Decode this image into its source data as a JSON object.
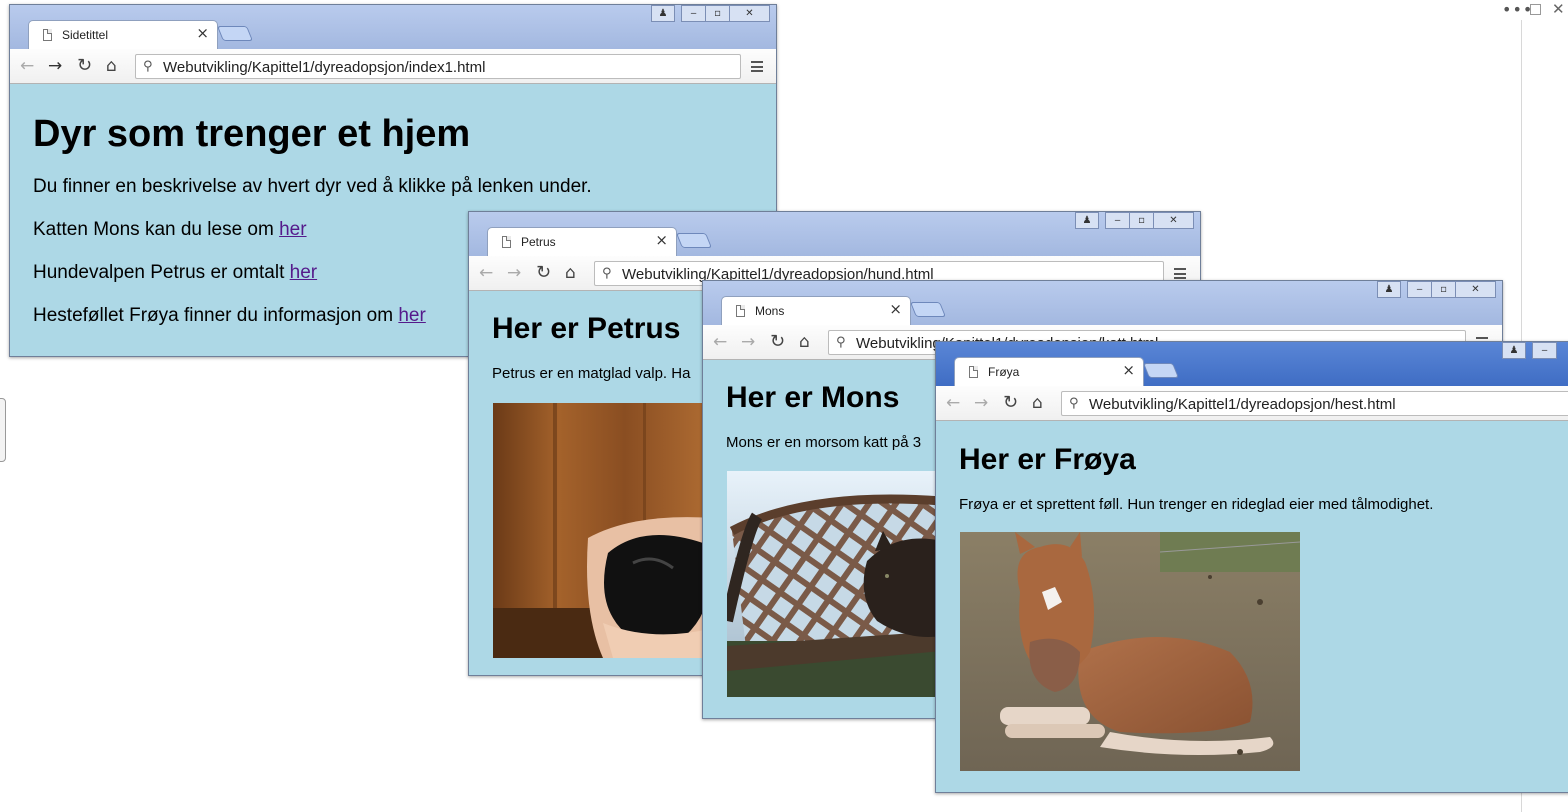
{
  "windows": {
    "index": {
      "tab_title": "Sidetittel",
      "url": "Webutvikling/Kapittel1/dyreadopsjon/index1.html",
      "heading": "Dyr som trenger et hjem",
      "intro": "Du finner en beskrivelse av hvert dyr ved å klikke på lenken under.",
      "lines": [
        {
          "text": "Katten Mons kan du lese om ",
          "link": "her"
        },
        {
          "text": "Hundevalpen Petrus er omtalt ",
          "link": "her"
        },
        {
          "text": "Hesteføllet Frøya finner du informasjon om ",
          "link": "her"
        }
      ]
    },
    "hund": {
      "tab_title": "Petrus",
      "url": "Webutvikling/Kapittel1/dyreadopsjon/hund.html",
      "heading": "Her er Petrus",
      "text": "Petrus er en matglad valp. Ha"
    },
    "katt": {
      "tab_title": "Mons",
      "url": "Webutvikling/Kapittel1/dyreadopsjon/katt.html",
      "heading": "Her er Mons",
      "text": "Mons er en morsom katt på 3"
    },
    "hest": {
      "tab_title": "Frøya",
      "url": "Webutvikling/Kapittel1/dyreadopsjon/hest.html",
      "heading": "Her er Frøya",
      "text": "Frøya er et sprettent føll. Hun trenger en rideglad eier med tålmodighet."
    }
  },
  "icons": {
    "page": "page-icon",
    "close": "close-icon",
    "back": "back-arrow-icon",
    "forward": "forward-arrow-icon",
    "reload": "reload-icon",
    "home": "home-icon",
    "search": "search-icon",
    "menu": "menu-icon",
    "user": "user-icon",
    "minimize": "minimize-icon",
    "restore": "restore-icon"
  },
  "colors": {
    "page_bg": "#add8e6",
    "link": "#551a8b",
    "frame_active": "#3f6dc4",
    "frame_inactive": "#a3b8e0"
  }
}
